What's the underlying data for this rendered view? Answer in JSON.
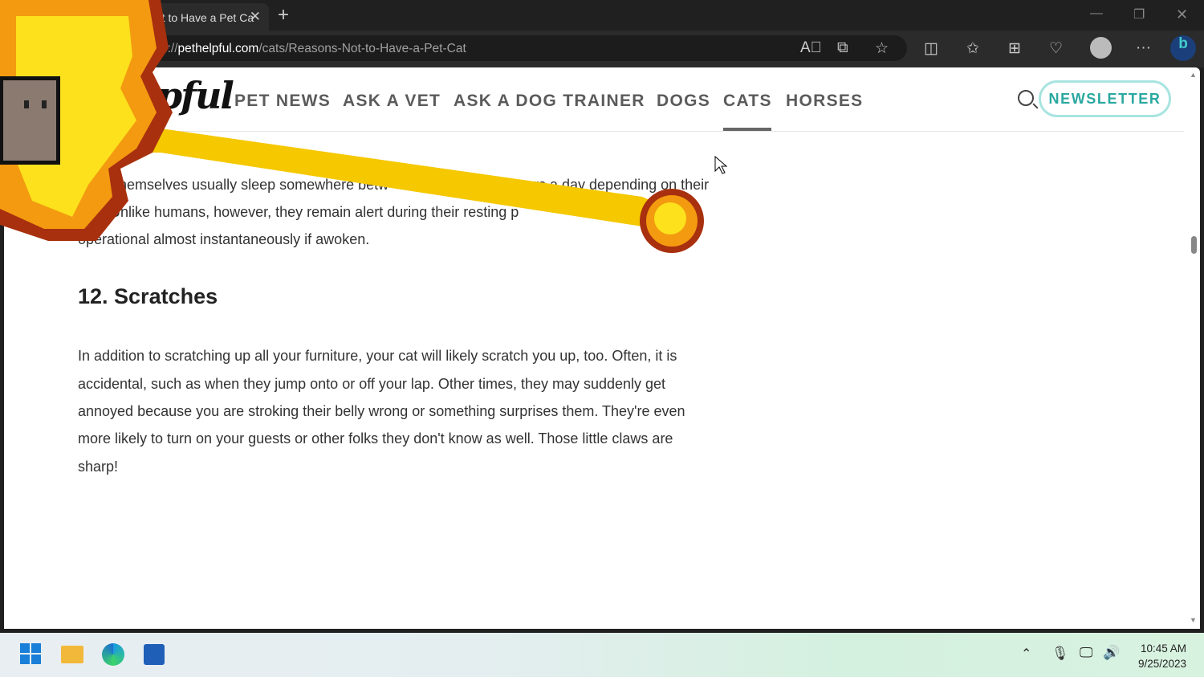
{
  "browser": {
    "tab_title": "5 Reasons Not to Have a Pet Ca",
    "url_domain": "pethelpful.com",
    "url_prefix": "https://",
    "url_path": "/cats/Reasons-Not-to-Have-a-Pet-Cat"
  },
  "site": {
    "logo": "pful",
    "nav": [
      "PET NEWS",
      "ASK A VET",
      "ASK A DOG TRAINER",
      "DOGS",
      "CATS",
      "HORSES"
    ],
    "active_nav": "CATS",
    "newsletter": "NEWSLETTER",
    "accent": "#2aa8a0"
  },
  "article": {
    "para1": {
      "line1a": "hemselves usually sleep somewhere betw",
      "line1b": "urs a day depending on their",
      "line2": "age. Unlike humans, however, they remain alert during their resting p",
      "line3": "operational almost instantaneously if awoken."
    },
    "heading": "12. Scratches",
    "para2": [
      "In addition to scratching up all your furniture, your cat will likely scratch you up, too. Often, it is",
      "accidental, such as when they jump onto or off your lap. Other times, they may suddenly get",
      "annoyed because you are stroking their belly wrong or something surprises them. They're even",
      "more likely to turn on your guests or other folks they don't know as well. Those little claws are",
      "sharp!"
    ]
  },
  "taskbar": {
    "time": "10:45 AM",
    "date": "9/25/2023"
  }
}
